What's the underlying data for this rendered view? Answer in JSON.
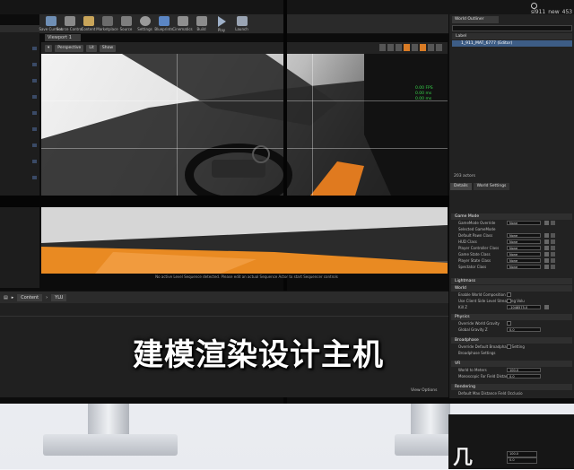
{
  "toolbar": {
    "items": [
      "Save Current",
      "Source Control",
      "Content",
      "Marketplace",
      "Source",
      "Settings",
      "Blueprints",
      "Cinematics",
      "Build",
      "Play",
      "Launch"
    ],
    "play_label": "Play"
  },
  "viewport": {
    "tab_label": "Viewport 1",
    "perspective_label": "Perspective",
    "lit_label": "Lit",
    "show_label": "Show",
    "stats": [
      "0.00 FPS",
      "0.00 ms",
      "0.00 ms"
    ],
    "message": "No active Level Sequence detected. Please edit an actual Sequence Actor to start Sequencer controls"
  },
  "content_browser": {
    "content_label": "Content",
    "path_label": "YLU",
    "view_options": "View Options"
  },
  "world_outliner": {
    "tab_label": "World Outliner",
    "column_label": "Label",
    "selected_item": "1_911_MAT_6777 (Editor)",
    "actor_count": "203 actors"
  },
  "details": {
    "tabs": [
      "Details",
      "World Settings"
    ],
    "sections": [
      "Game Mode",
      "Lightmass",
      "World",
      "Physics",
      "Broadphase",
      "VR",
      "Rendering"
    ],
    "game_mode_props": [
      {
        "label": "GameMode Override",
        "value": "None"
      },
      {
        "label": "Selected GameMode",
        "value": ""
      },
      {
        "label": "Default Pawn Class",
        "value": "None"
      },
      {
        "label": "HUD Class",
        "value": "None"
      },
      {
        "label": "Player Controller Class",
        "value": "None"
      },
      {
        "label": "Game State Class",
        "value": "None"
      },
      {
        "label": "Player State Class",
        "value": "None"
      },
      {
        "label": "Spectator Class",
        "value": "None"
      }
    ],
    "world_props": [
      {
        "label": "Enable World Composition"
      },
      {
        "label": "Use Client Side Level Streaming Volu"
      },
      {
        "label": "Kill Z",
        "value": "-1048575.0"
      }
    ],
    "physics_props": [
      {
        "label": "Override World Gravity"
      },
      {
        "label": "Global Gravity Z",
        "value": "0.0"
      }
    ],
    "broadphase_props": [
      {
        "label": "Override Default Broadphase Setting"
      },
      {
        "label": "Broadphase Settings"
      }
    ],
    "vr_props": [
      {
        "label": "World to Meters",
        "value": "100.0"
      },
      {
        "label": "Monoscopic Far Field Distance",
        "value": "0.0"
      }
    ],
    "rendering_props": [
      {
        "label": "Default Max Distance Field Occlusio"
      }
    ],
    "second_monitor_props": [
      {
        "label": "",
        "value": "100.0"
      },
      {
        "label": "",
        "value": "0.0"
      }
    ]
  },
  "overlay_title": "建模渲染设计主机",
  "corner_char": "几"
}
